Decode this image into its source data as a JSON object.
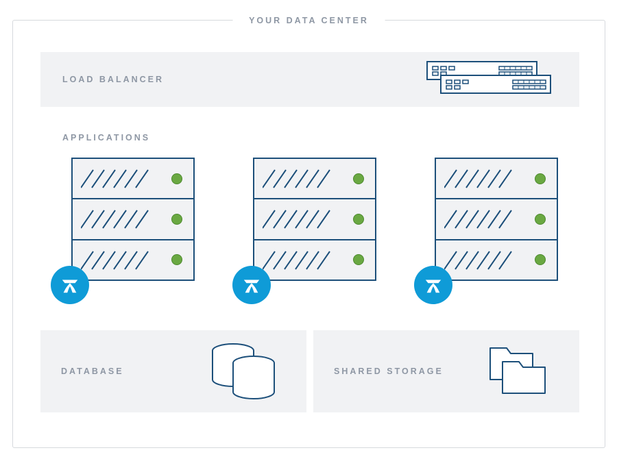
{
  "title": "YOUR DATA CENTER",
  "sections": {
    "load_balancer_label": "LOAD BALANCER",
    "applications_label": "APPLICATIONS",
    "database_label": "DATABASE",
    "shared_storage_label": "SHARED STORAGE"
  },
  "colors": {
    "outline": "#1c4f7a",
    "panel_bg": "#f1f2f4",
    "status_light": "#6aa842",
    "badge": "#0f9bd7",
    "label_text": "#8e97a4",
    "frame_border": "#d6d9dd"
  },
  "icons": {
    "load_balancer": "rack-unit-icon",
    "server": "server-rack-icon",
    "app_badge": "atlassian-icon",
    "database": "database-disks-icon",
    "storage": "folders-icon"
  },
  "application_servers": 3
}
